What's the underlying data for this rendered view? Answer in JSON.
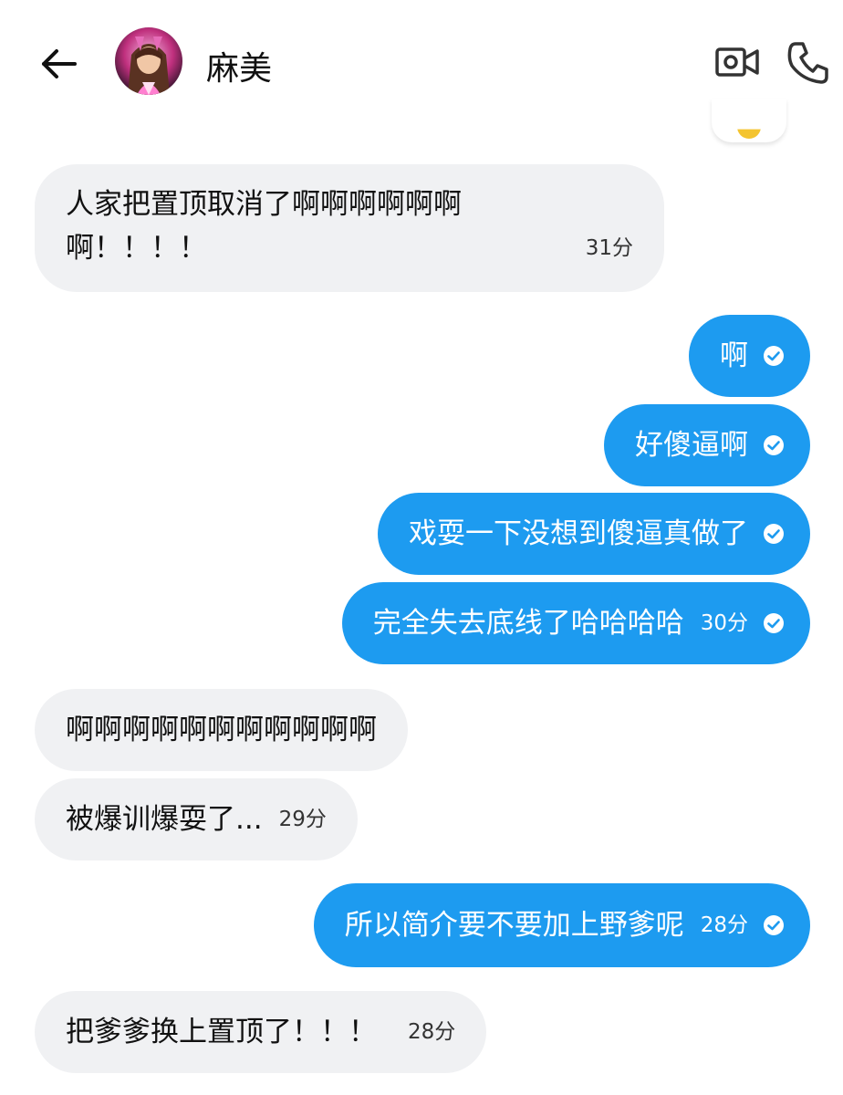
{
  "header": {
    "contact_name": "麻美",
    "back_icon": "arrow-left-icon",
    "video_icon": "video-call-icon",
    "phone_icon": "phone-icon"
  },
  "messages": [
    {
      "direction": "in",
      "text": "人家把置顶取消了啊啊啊啊啊啊\n啊！！！！",
      "time": "31分"
    },
    {
      "direction": "out",
      "text": "啊",
      "time": "",
      "read": true
    },
    {
      "direction": "out",
      "text": "好傻逼啊",
      "time": "",
      "read": true
    },
    {
      "direction": "out",
      "text": "戏耍一下没想到傻逼真做了",
      "time": "",
      "read": true
    },
    {
      "direction": "out",
      "text": "完全失去底线了哈哈哈哈",
      "time": "30分",
      "read": true
    },
    {
      "direction": "in",
      "text": "啊啊啊啊啊啊啊啊啊啊啊",
      "time": ""
    },
    {
      "direction": "in",
      "text": "被爆训爆耍了...",
      "time": "29分"
    },
    {
      "direction": "out",
      "text": "所以简介要不要加上野爹呢",
      "time": "28分",
      "read": true
    },
    {
      "direction": "in",
      "text": "把爹爹换上置顶了！！！",
      "time": "28分"
    }
  ],
  "colors": {
    "outgoing_bubble": "#1d9bf0",
    "incoming_bubble": "#f0f1f3"
  }
}
